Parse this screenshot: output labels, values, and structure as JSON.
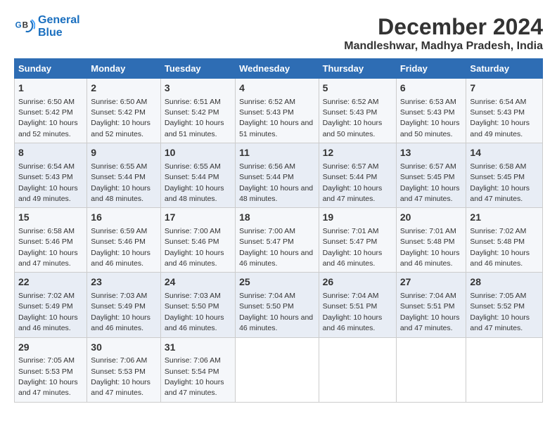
{
  "logo": {
    "line1": "General",
    "line2": "Blue"
  },
  "title": "December 2024",
  "subtitle": "Mandleshwar, Madhya Pradesh, India",
  "headers": [
    "Sunday",
    "Monday",
    "Tuesday",
    "Wednesday",
    "Thursday",
    "Friday",
    "Saturday"
  ],
  "weeks": [
    [
      {
        "day": "1",
        "rise": "Sunrise: 6:50 AM",
        "set": "Sunset: 5:42 PM",
        "daylight": "Daylight: 10 hours and 52 minutes."
      },
      {
        "day": "2",
        "rise": "Sunrise: 6:50 AM",
        "set": "Sunset: 5:42 PM",
        "daylight": "Daylight: 10 hours and 52 minutes."
      },
      {
        "day": "3",
        "rise": "Sunrise: 6:51 AM",
        "set": "Sunset: 5:42 PM",
        "daylight": "Daylight: 10 hours and 51 minutes."
      },
      {
        "day": "4",
        "rise": "Sunrise: 6:52 AM",
        "set": "Sunset: 5:43 PM",
        "daylight": "Daylight: 10 hours and 51 minutes."
      },
      {
        "day": "5",
        "rise": "Sunrise: 6:52 AM",
        "set": "Sunset: 5:43 PM",
        "daylight": "Daylight: 10 hours and 50 minutes."
      },
      {
        "day": "6",
        "rise": "Sunrise: 6:53 AM",
        "set": "Sunset: 5:43 PM",
        "daylight": "Daylight: 10 hours and 50 minutes."
      },
      {
        "day": "7",
        "rise": "Sunrise: 6:54 AM",
        "set": "Sunset: 5:43 PM",
        "daylight": "Daylight: 10 hours and 49 minutes."
      }
    ],
    [
      {
        "day": "8",
        "rise": "Sunrise: 6:54 AM",
        "set": "Sunset: 5:43 PM",
        "daylight": "Daylight: 10 hours and 49 minutes."
      },
      {
        "day": "9",
        "rise": "Sunrise: 6:55 AM",
        "set": "Sunset: 5:44 PM",
        "daylight": "Daylight: 10 hours and 48 minutes."
      },
      {
        "day": "10",
        "rise": "Sunrise: 6:55 AM",
        "set": "Sunset: 5:44 PM",
        "daylight": "Daylight: 10 hours and 48 minutes."
      },
      {
        "day": "11",
        "rise": "Sunrise: 6:56 AM",
        "set": "Sunset: 5:44 PM",
        "daylight": "Daylight: 10 hours and 48 minutes."
      },
      {
        "day": "12",
        "rise": "Sunrise: 6:57 AM",
        "set": "Sunset: 5:44 PM",
        "daylight": "Daylight: 10 hours and 47 minutes."
      },
      {
        "day": "13",
        "rise": "Sunrise: 6:57 AM",
        "set": "Sunset: 5:45 PM",
        "daylight": "Daylight: 10 hours and 47 minutes."
      },
      {
        "day": "14",
        "rise": "Sunrise: 6:58 AM",
        "set": "Sunset: 5:45 PM",
        "daylight": "Daylight: 10 hours and 47 minutes."
      }
    ],
    [
      {
        "day": "15",
        "rise": "Sunrise: 6:58 AM",
        "set": "Sunset: 5:46 PM",
        "daylight": "Daylight: 10 hours and 47 minutes."
      },
      {
        "day": "16",
        "rise": "Sunrise: 6:59 AM",
        "set": "Sunset: 5:46 PM",
        "daylight": "Daylight: 10 hours and 46 minutes."
      },
      {
        "day": "17",
        "rise": "Sunrise: 7:00 AM",
        "set": "Sunset: 5:46 PM",
        "daylight": "Daylight: 10 hours and 46 minutes."
      },
      {
        "day": "18",
        "rise": "Sunrise: 7:00 AM",
        "set": "Sunset: 5:47 PM",
        "daylight": "Daylight: 10 hours and 46 minutes."
      },
      {
        "day": "19",
        "rise": "Sunrise: 7:01 AM",
        "set": "Sunset: 5:47 PM",
        "daylight": "Daylight: 10 hours and 46 minutes."
      },
      {
        "day": "20",
        "rise": "Sunrise: 7:01 AM",
        "set": "Sunset: 5:48 PM",
        "daylight": "Daylight: 10 hours and 46 minutes."
      },
      {
        "day": "21",
        "rise": "Sunrise: 7:02 AM",
        "set": "Sunset: 5:48 PM",
        "daylight": "Daylight: 10 hours and 46 minutes."
      }
    ],
    [
      {
        "day": "22",
        "rise": "Sunrise: 7:02 AM",
        "set": "Sunset: 5:49 PM",
        "daylight": "Daylight: 10 hours and 46 minutes."
      },
      {
        "day": "23",
        "rise": "Sunrise: 7:03 AM",
        "set": "Sunset: 5:49 PM",
        "daylight": "Daylight: 10 hours and 46 minutes."
      },
      {
        "day": "24",
        "rise": "Sunrise: 7:03 AM",
        "set": "Sunset: 5:50 PM",
        "daylight": "Daylight: 10 hours and 46 minutes."
      },
      {
        "day": "25",
        "rise": "Sunrise: 7:04 AM",
        "set": "Sunset: 5:50 PM",
        "daylight": "Daylight: 10 hours and 46 minutes."
      },
      {
        "day": "26",
        "rise": "Sunrise: 7:04 AM",
        "set": "Sunset: 5:51 PM",
        "daylight": "Daylight: 10 hours and 46 minutes."
      },
      {
        "day": "27",
        "rise": "Sunrise: 7:04 AM",
        "set": "Sunset: 5:51 PM",
        "daylight": "Daylight: 10 hours and 47 minutes."
      },
      {
        "day": "28",
        "rise": "Sunrise: 7:05 AM",
        "set": "Sunset: 5:52 PM",
        "daylight": "Daylight: 10 hours and 47 minutes."
      }
    ],
    [
      {
        "day": "29",
        "rise": "Sunrise: 7:05 AM",
        "set": "Sunset: 5:53 PM",
        "daylight": "Daylight: 10 hours and 47 minutes."
      },
      {
        "day": "30",
        "rise": "Sunrise: 7:06 AM",
        "set": "Sunset: 5:53 PM",
        "daylight": "Daylight: 10 hours and 47 minutes."
      },
      {
        "day": "31",
        "rise": "Sunrise: 7:06 AM",
        "set": "Sunset: 5:54 PM",
        "daylight": "Daylight: 10 hours and 47 minutes."
      },
      null,
      null,
      null,
      null
    ]
  ]
}
